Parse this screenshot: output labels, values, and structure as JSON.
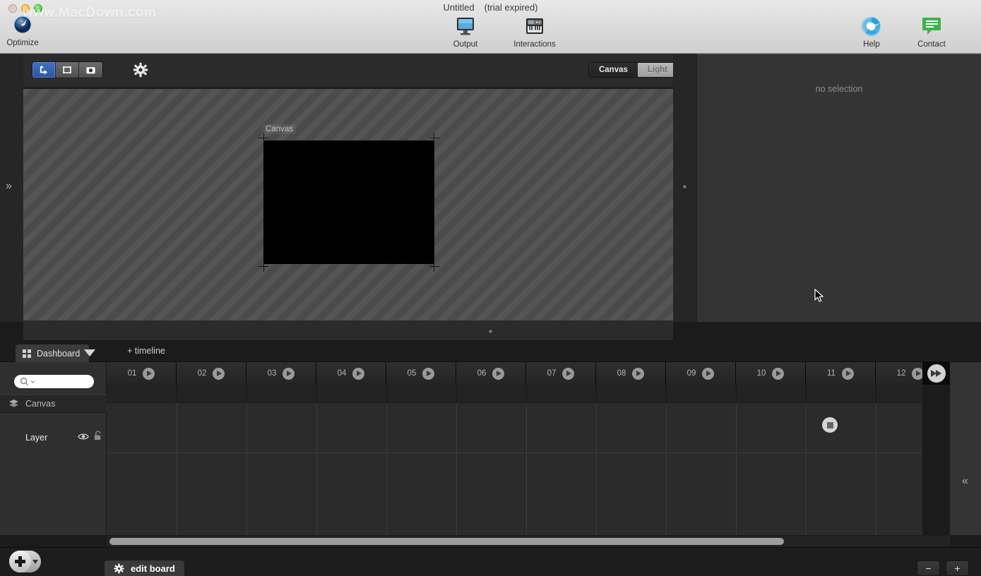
{
  "window": {
    "watermark": "www.MacDown.com",
    "document_title": "Untitled",
    "trial_status": "(trial expired)",
    "traffic_lights": [
      "close-button",
      "minimize-button",
      "maximize-button"
    ]
  },
  "toolbar": {
    "items": [
      {
        "label": "Optimize",
        "icon": "gauge-icon"
      },
      {
        "label": "Output",
        "icon": "display-monitor-icon"
      },
      {
        "label": "Interactions",
        "icon": "midi-keyboard-icon"
      },
      {
        "label": "Help",
        "icon": "life-preserver-icon"
      },
      {
        "label": "Contact",
        "icon": "speech-bubble-icon"
      }
    ]
  },
  "editor": {
    "tools": [
      {
        "name": "move-tool",
        "icon": "arrow-move-icon",
        "selected": true
      },
      {
        "name": "crop-tool",
        "icon": "frame-icon",
        "selected": false
      },
      {
        "name": "camera-tool",
        "icon": "camera-icon",
        "selected": false
      }
    ],
    "settings_icon": "gear-icon",
    "view_toggle": {
      "options": [
        "Canvas",
        "Light"
      ],
      "selected": "Canvas"
    },
    "stage_label": "Canvas"
  },
  "inspector": {
    "empty_message": "no selection"
  },
  "rails": {
    "expand_left_icon": "chevron-double-right-icon",
    "collapse_right_icon": "chevron-double-left-icon"
  },
  "tabs": {
    "dashboard_label": "Dashboard",
    "dashboard_icon": "grid-icon",
    "dropdown_icon": "triangle-down-icon",
    "add_timeline_label": "+ timeline"
  },
  "timeline": {
    "search": {
      "placeholder": "",
      "value": "",
      "icon": "search-icon"
    },
    "group": {
      "name": "Canvas",
      "icon": "layers-icon"
    },
    "layer": {
      "name": "Layer",
      "visibility_icon": "eye-icon",
      "lock_icon": "unlock-icon",
      "record_icon": "record-stop-icon"
    },
    "columns": [
      {
        "num": "01",
        "icon": "play-icon"
      },
      {
        "num": "02",
        "icon": "play-icon"
      },
      {
        "num": "03",
        "icon": "play-icon"
      },
      {
        "num": "04",
        "icon": "play-icon"
      },
      {
        "num": "05",
        "icon": "play-icon"
      },
      {
        "num": "06",
        "icon": "play-icon"
      },
      {
        "num": "07",
        "icon": "play-icon"
      },
      {
        "num": "08",
        "icon": "play-icon"
      },
      {
        "num": "09",
        "icon": "play-icon"
      },
      {
        "num": "10",
        "icon": "play-icon"
      },
      {
        "num": "11",
        "icon": "play-icon"
      },
      {
        "num": "12",
        "icon": "play-icon"
      }
    ],
    "fast_forward_icon": "fast-forward-icon"
  },
  "bottom_bar": {
    "add_label": "add-button",
    "add_icon": "plus-icon",
    "add_dropdown_icon": "triangle-down-icon",
    "edit_board_label": "edit board",
    "edit_board_icon": "gear-icon",
    "zoom_out_label": "−",
    "zoom_in_label": "+"
  },
  "colors": {
    "accent_blue": "#3f70c4",
    "contact_green": "#3cb44b",
    "help_blue": "#3aa6dd",
    "panel_dark": "#2b2b2b",
    "canvas_black": "#000000"
  }
}
